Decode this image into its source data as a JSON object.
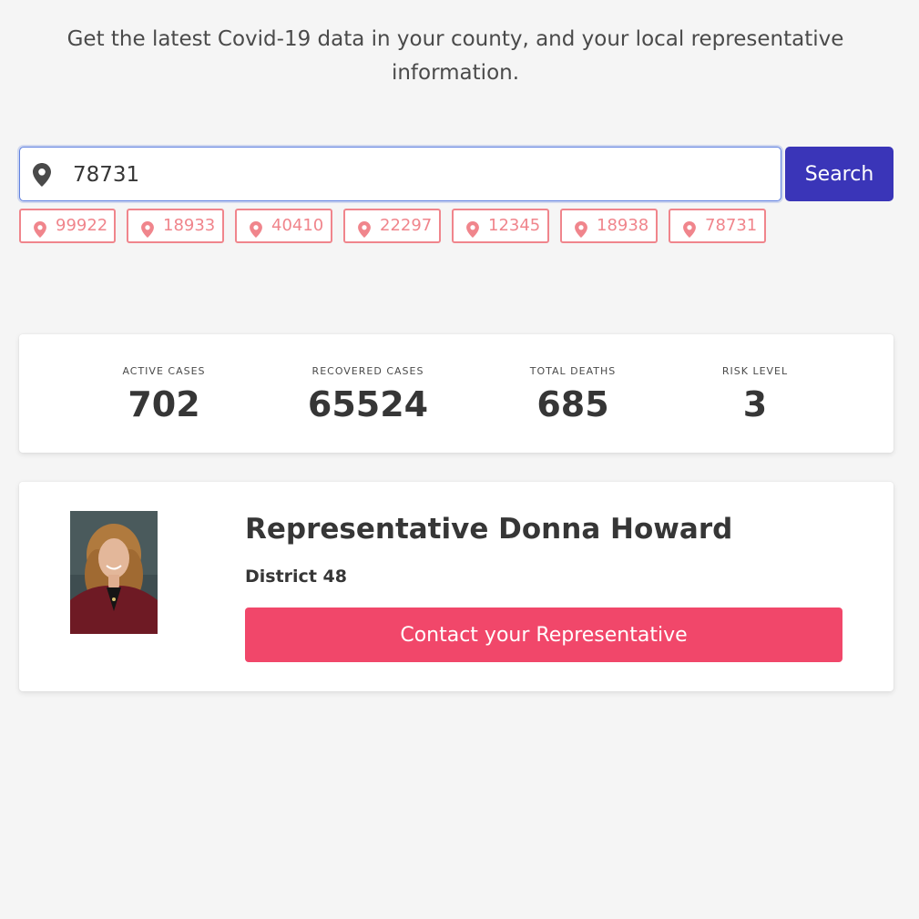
{
  "intro": {
    "line1": "Get the latest Covid-19 data in your county, and your local representative",
    "line2": "information."
  },
  "search": {
    "icon": "map-marker-icon",
    "value": "78731",
    "button_label": "Search"
  },
  "recent_zips": [
    "99922",
    "18933",
    "40410",
    "22297",
    "12345",
    "18938",
    "78731"
  ],
  "stats": [
    {
      "label": "ACTIVE CASES",
      "value": "702"
    },
    {
      "label": "RECOVERED CASES",
      "value": "65524"
    },
    {
      "label": "TOTAL DEATHS",
      "value": "685"
    },
    {
      "label": "RISK LEVEL",
      "value": "3"
    }
  ],
  "representative": {
    "name": "Representative Donna Howard",
    "district": "District 48",
    "contact_label": "Contact your Representative"
  },
  "colors": {
    "page_bg": "#f5f5f5",
    "search_button": "#3a35b8",
    "chip_accent": "#f0858c",
    "contact_button": "#f1476a"
  }
}
